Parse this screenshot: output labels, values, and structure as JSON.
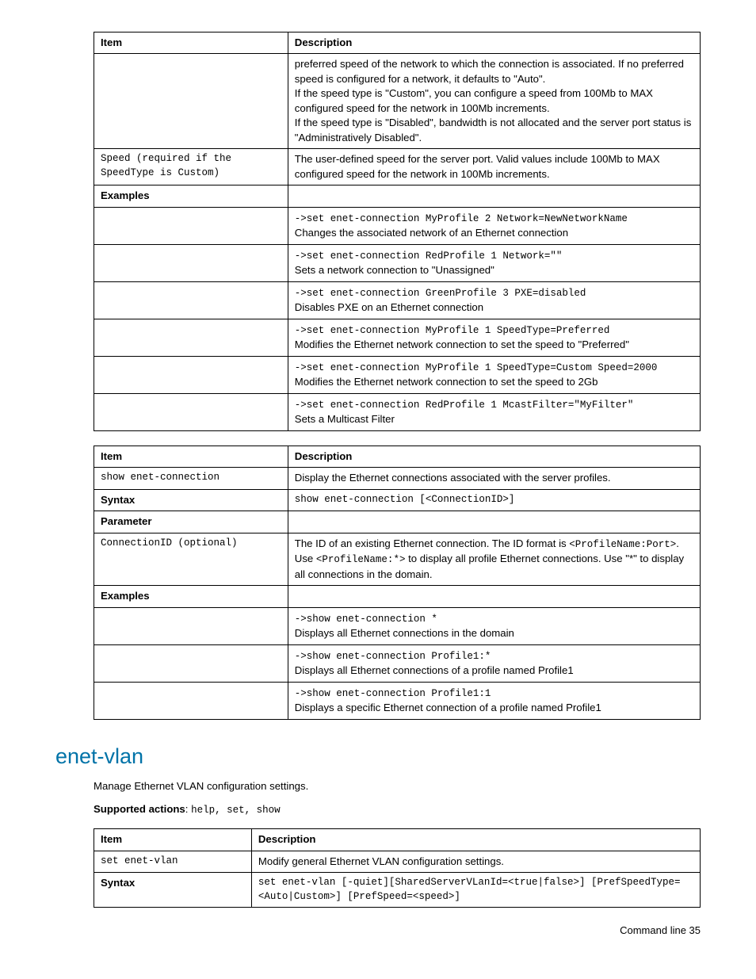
{
  "table1": {
    "h1": "Item",
    "h2": "Description",
    "r0": {
      "item": "",
      "desc": "preferred speed of the network to which the connection is associated. If no preferred speed is configured for a network, it defaults to \"Auto\".\nIf the speed type is \"Custom\", you can configure a speed from 100Mb to MAX configured speed for the network in 100Mb increments.\nIf the speed type is \"Disabled\", bandwidth is not allocated and the server port status is \"Administratively Disabled\"."
    },
    "r1": {
      "item": "Speed (required if the SpeedType is Custom)",
      "desc": "The user-defined speed for the server port. Valid values include 100Mb to MAX configured speed for the network in 100Mb increments."
    },
    "examplesLabel": "Examples",
    "ex1_cmd": "->set enet-connection MyProfile 2 Network=NewNetworkName",
    "ex1_d": "Changes the associated network of an Ethernet connection",
    "ex2_cmd": "->set enet-connection RedProfile 1 Network=\"\"",
    "ex2_d": "Sets a network connection to \"Unassigned\"",
    "ex3_cmd": "->set enet-connection GreenProfile 3 PXE=disabled",
    "ex3_d": "Disables PXE on an Ethernet connection",
    "ex4_cmd": "->set enet-connection MyProfile 1 SpeedType=Preferred",
    "ex4_d": "Modifies the Ethernet network connection to set the speed to \"Preferred\"",
    "ex5_cmd": "->set enet-connection MyProfile 1 SpeedType=Custom Speed=2000",
    "ex5_d": "Modifies the Ethernet network connection to set the speed to 2Gb",
    "ex6_cmd": "->set enet-connection RedProfile 1 McastFilter=\"MyFilter\"",
    "ex6_d": "Sets a Multicast Filter"
  },
  "table2": {
    "h1": "Item",
    "h2": "Description",
    "r0_item": "show enet-connection",
    "r0_desc": "Display the Ethernet connections associated with the server profiles.",
    "syntaxLabel": "Syntax",
    "syntaxVal": "show enet-connection [<ConnectionID>]",
    "paramLabel": "Parameter",
    "p1_item": "ConnectionID (optional)",
    "p1_d_pre": "The ID of an existing Ethernet connection. The ID format is ",
    "p1_d_code1": "<ProfileName:Port>",
    "p1_d_mid": ". Use ",
    "p1_d_code2": "<ProfileName:*>",
    "p1_d_post": " to display all profile Ethernet connections. Use \"*\" to display all connections in the domain.",
    "examplesLabel": "Examples",
    "ex1_cmd": "->show enet-connection *",
    "ex1_d": "Displays all Ethernet connections in the domain",
    "ex2_cmd": "->show enet-connection Profile1:*",
    "ex2_d": "Displays all Ethernet connections of a profile named Profile1",
    "ex3_cmd": "->show enet-connection Profile1:1",
    "ex3_d": "Displays a specific Ethernet connection of a profile named Profile1"
  },
  "sectionTitle": "enet-vlan",
  "introText": "Manage Ethernet VLAN configuration settings.",
  "supportedLabel": "Supported actions",
  "supportedVal": "help, set, show",
  "table3": {
    "h1": "Item",
    "h2": "Description",
    "r0_item": "set enet-vlan",
    "r0_desc": "Modify general Ethernet VLAN configuration settings.",
    "syntaxLabel": "Syntax",
    "syntaxVal": "set enet-vlan [-quiet][SharedServerVLanId=<true|false>] [PrefSpeedType=<Auto|Custom>] [PrefSpeed=<speed>]"
  },
  "footer": "Command line  35"
}
